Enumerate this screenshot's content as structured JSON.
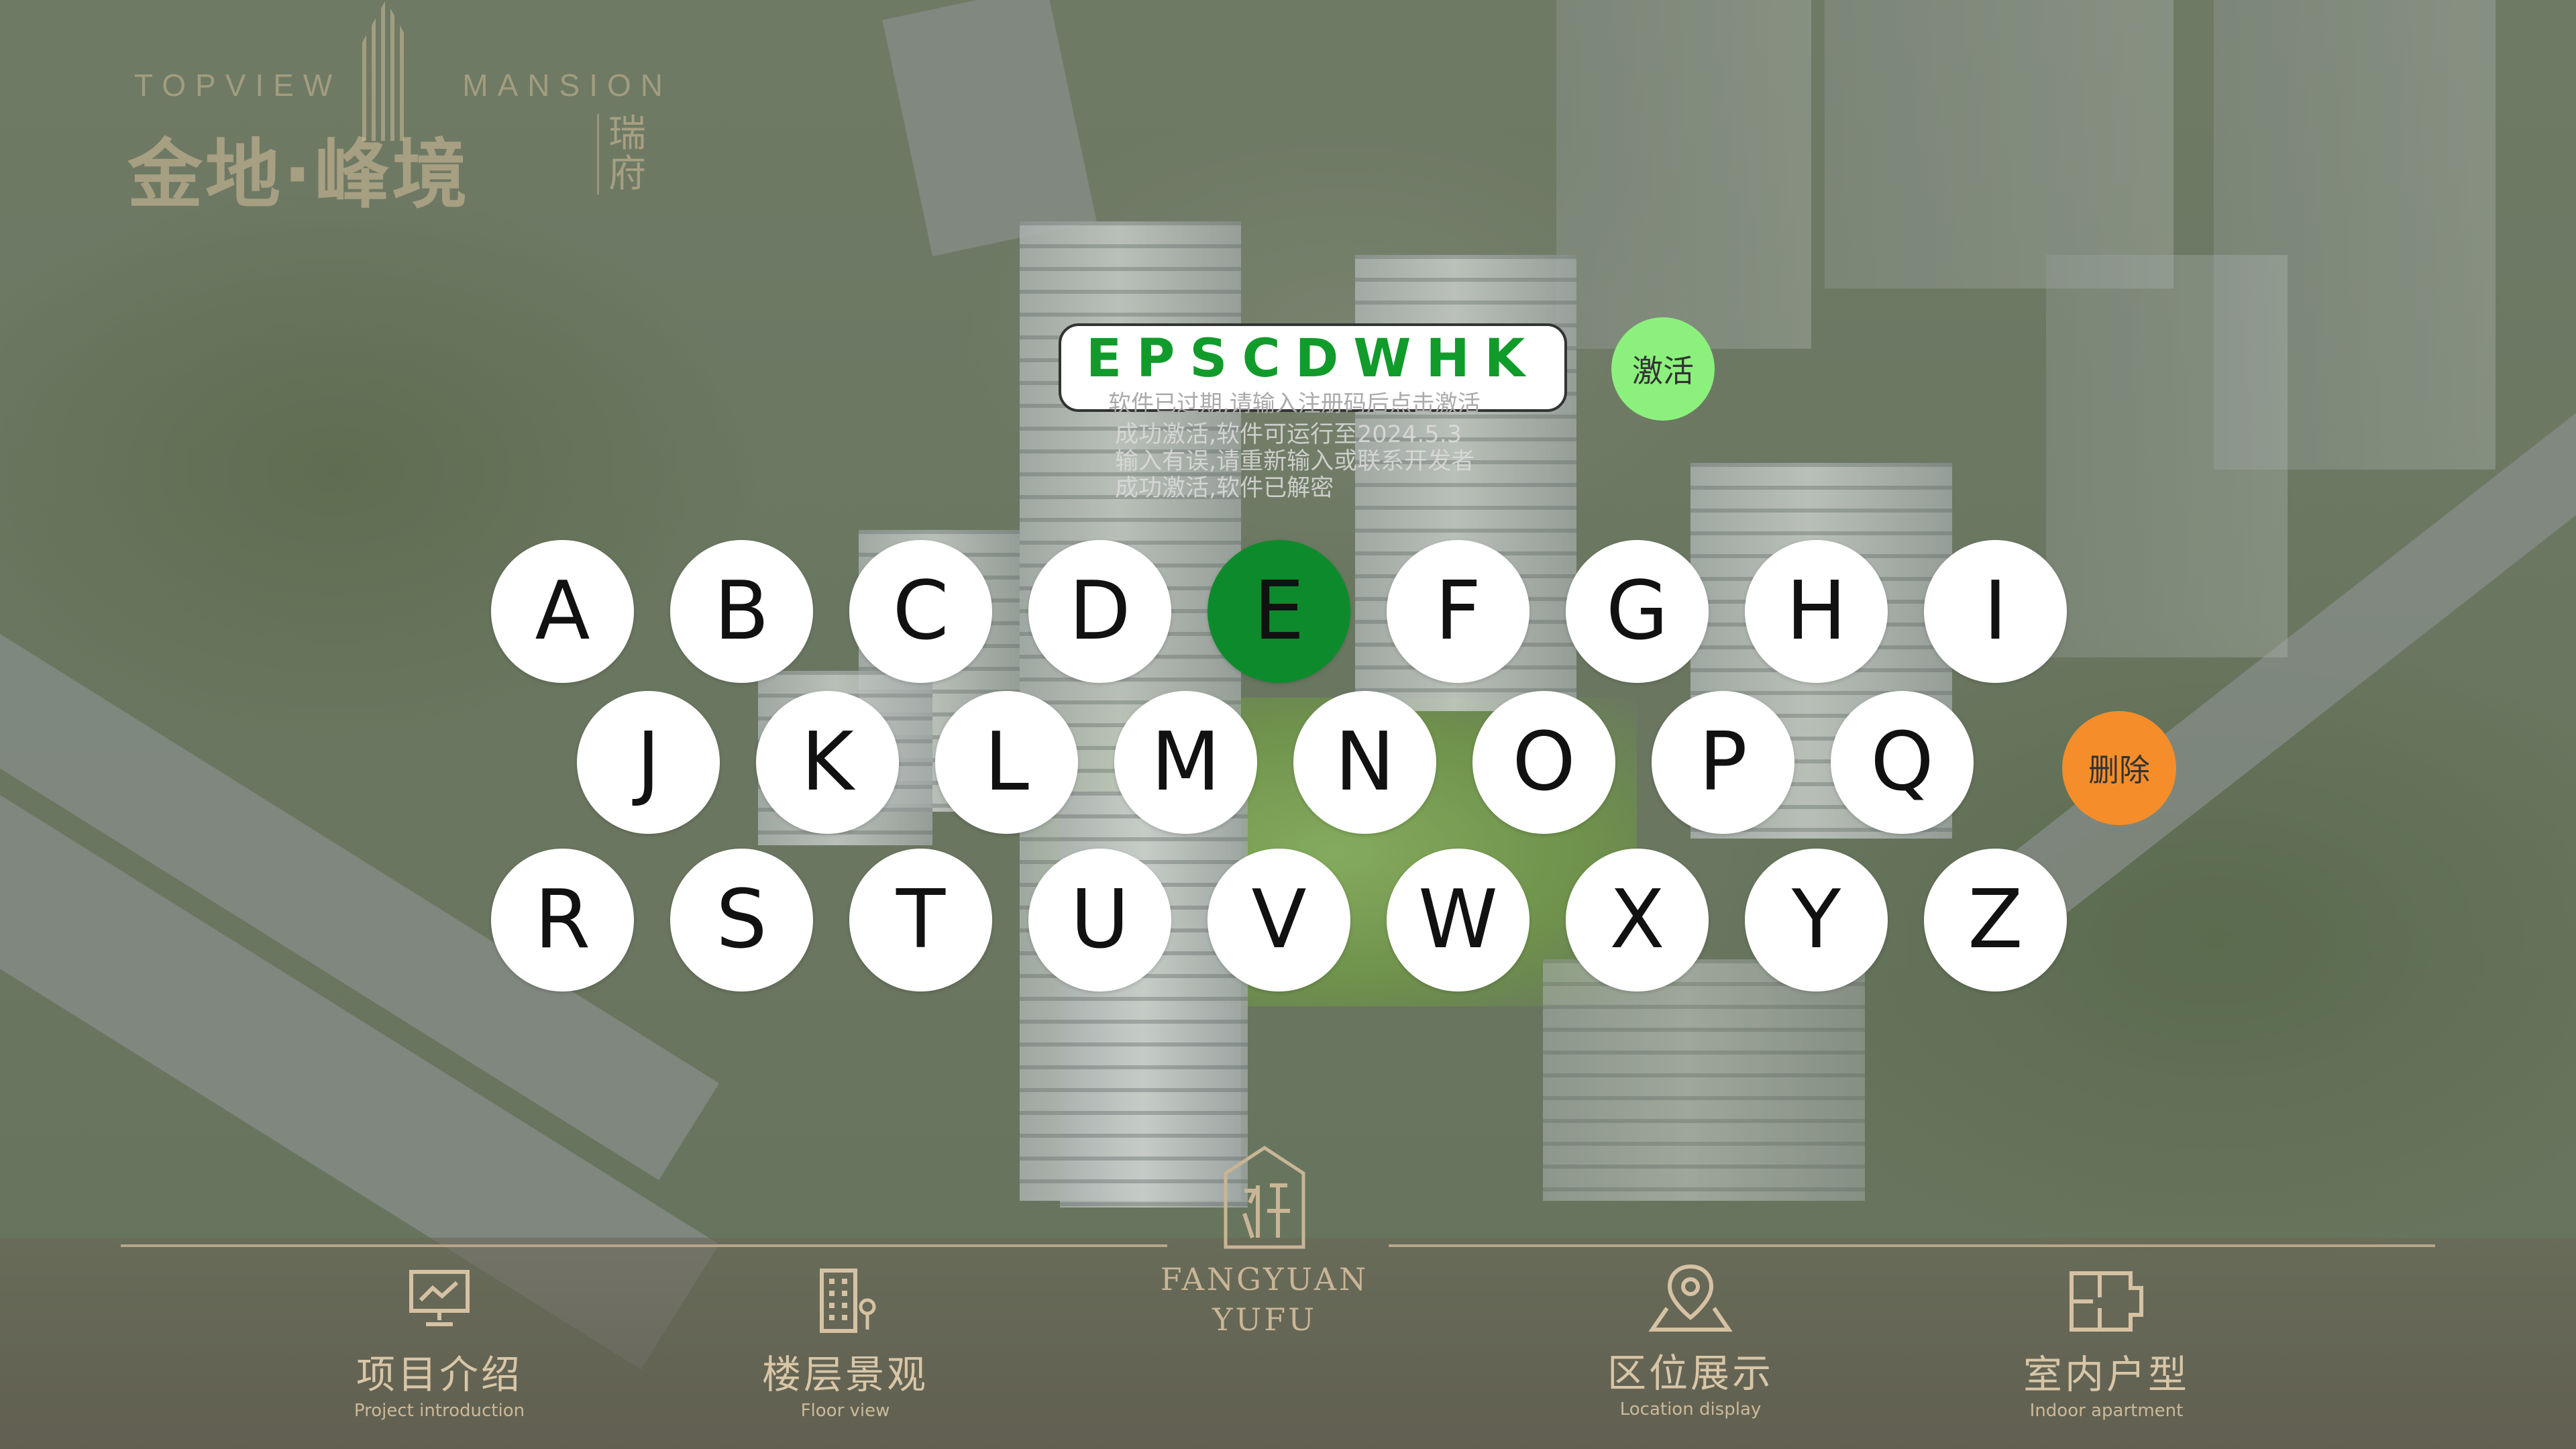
{
  "logo": {
    "en_left": "TOPVIEW",
    "en_right": "MANSION",
    "cn": "金地·峰境",
    "side": "瑞府"
  },
  "activation": {
    "code": "EPSCDWHK",
    "placeholder": "软件已过期,请输入注册码后点击激活",
    "messages": [
      "成功激活,软件可运行至2024.5.3",
      "输入有误,请重新输入或联系开发者",
      "成功激活,软件已解密"
    ],
    "activate_label": "激活",
    "delete_label": "删除"
  },
  "keyboard": {
    "row1": [
      "A",
      "B",
      "C",
      "D",
      "E",
      "F",
      "G",
      "H",
      "I"
    ],
    "row2": [
      "J",
      "K",
      "L",
      "M",
      "N",
      "O",
      "P",
      "Q"
    ],
    "row3": [
      "R",
      "S",
      "T",
      "U",
      "V",
      "W",
      "X",
      "Y",
      "Z"
    ],
    "active_key": "E"
  },
  "nav": {
    "items": [
      {
        "cn": "项目介绍",
        "en": "Project introduction",
        "icon": "presentation-board-icon"
      },
      {
        "cn": "楼层景观",
        "en": "Floor view",
        "icon": "building-location-icon"
      },
      {
        "cn": "区位展示",
        "en": "Location display",
        "icon": "map-pin-icon"
      },
      {
        "cn": "室内户型",
        "en": "Indoor apartment",
        "icon": "floor-plan-icon"
      }
    ],
    "center_line1": "FANGYUAN",
    "center_line2": "YUFU"
  },
  "colors": {
    "code_green": "#119b2b",
    "active_key": "#0d8b2c",
    "activate_btn": "#8cf07d",
    "delete_btn": "#f58e2a",
    "nav_gold": "#d6c2a3"
  }
}
